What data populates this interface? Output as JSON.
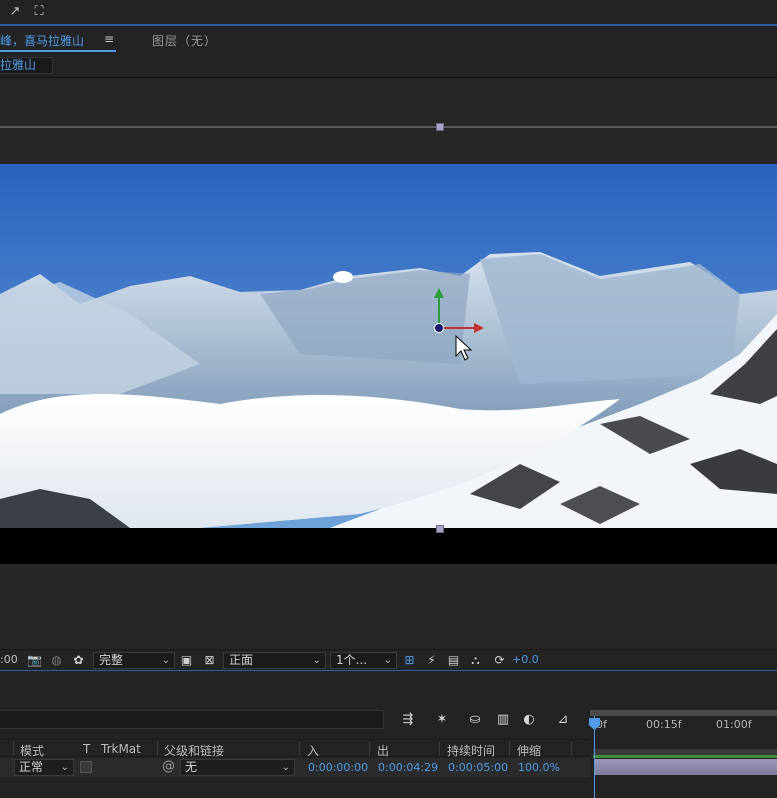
{
  "topbar": {
    "tools": [
      "arrow-tool",
      "snap-tool"
    ]
  },
  "tabs": {
    "composition_label": "峰，喜马拉雅山",
    "menu_glyph": "≡",
    "layer_label": "图层（无）"
  },
  "breadcrumb": {
    "label": "拉雅山"
  },
  "viewer_toolbar": {
    "time_fragment": ":00",
    "resolution": "完整",
    "view": "正面",
    "views_count": "1个...",
    "exposure": "+0.0"
  },
  "timeline": {
    "ruler_ticks": [
      "0f",
      "00:15f",
      "01:00f"
    ],
    "columns": {
      "mode": "模式",
      "t": "T",
      "trkmat": "TrkMat",
      "parent": "父级和链接",
      "in": "入",
      "out": "出",
      "duration": "持续时间",
      "stretch": "伸缩"
    },
    "layer": {
      "mode": "正常",
      "parent": "无",
      "in": "0:00:00:00",
      "out": "0:00:04:29",
      "duration": "0:00:05:00",
      "stretch": "100.0%"
    }
  },
  "colors": {
    "accent": "#4f9be8",
    "panel": "#232323",
    "sky": "#2f6cc4"
  }
}
